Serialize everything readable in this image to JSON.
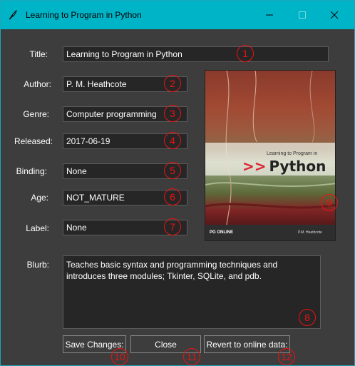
{
  "window": {
    "title": "Learning to Program in Python"
  },
  "form": {
    "title_label": "Title:",
    "title_value": "Learning to Program in Python",
    "author_label": "Author:",
    "author_value": "P. M. Heathcote",
    "genre_label": "Genre:",
    "genre_value": "Computer programming",
    "released_label": "Released:",
    "released_value": "2017-06-19",
    "binding_label": "Binding:",
    "binding_value": "None",
    "age_label": "Age:",
    "age_value": "NOT_MATURE",
    "label_label": "Label:",
    "label_value": "None",
    "blurb_label": "Blurb:",
    "blurb_value": "Teaches basic syntax and programming techniques and introduces three modules; Tkinter, SQLite, and pdb."
  },
  "cover": {
    "subtitle": "Learning to Program in",
    "arrows": ">>",
    "word": "Python",
    "publisher": "PG ONLINE",
    "author_small": "P.M. Heathcote"
  },
  "buttons": {
    "save": "Save Changes:",
    "close": "Close",
    "revert": "Revert to online data:"
  },
  "markers": [
    "1",
    "2",
    "3",
    "4",
    "5",
    "6",
    "7",
    "8",
    "9",
    "10",
    "11",
    "12"
  ],
  "colors": {
    "titlebar": "#00b4c8",
    "background": "#3d3d3d",
    "field_bg": "#262626",
    "marker": "#ee1111"
  }
}
